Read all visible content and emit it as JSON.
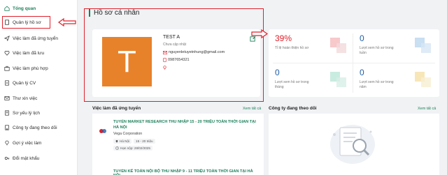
{
  "sidebar": {
    "items": [
      {
        "label": "Tổng quan",
        "icon": "home-icon"
      },
      {
        "label": "Quản lý hồ sơ",
        "icon": "document-icon"
      },
      {
        "label": "Việc làm đã ứng tuyển",
        "icon": "send-icon"
      },
      {
        "label": "Việc làm đã lưu",
        "icon": "heart-icon"
      },
      {
        "label": "Việc làm phù hợp",
        "icon": "briefcase-icon"
      },
      {
        "label": "Quản lý CV",
        "icon": "cv-icon"
      },
      {
        "label": "Thư xin việc",
        "icon": "mail-icon"
      },
      {
        "label": "Sơ yếu lý lịch",
        "icon": "resume-icon"
      },
      {
        "label": "Công ty đang theo dõi",
        "icon": "company-icon"
      },
      {
        "label": "Gợi ý việc làm",
        "icon": "suggest-icon"
      },
      {
        "label": "Đổi mật khẩu",
        "icon": "key-icon"
      }
    ]
  },
  "main": {
    "title": "Hồ sơ cá nhân",
    "profile": {
      "avatar_letter": "T",
      "name": "TEST A",
      "status": "Chưa cập nhật",
      "email": "nguyenletuyetnhung@gmail.com",
      "phone": "0987654321"
    },
    "stats": [
      {
        "value": "39%",
        "label": "Tỉ lệ hoàn thiện hồ sơ",
        "color": "#e0202a"
      },
      {
        "value": "0",
        "label": "Lượt xem hồ sơ trong tuần",
        "color": "#1f5fa8"
      },
      {
        "value": "0",
        "label": "Lượt xem hồ sơ trong tháng",
        "color": "#1f5fa8"
      },
      {
        "value": "0",
        "label": "Lượt xem hồ sơ trong năm",
        "color": "#1f5fa8"
      }
    ],
    "applied_jobs": {
      "title": "Việc làm đã ứng tuyển",
      "see_all": "Xem tất cả",
      "jobs": [
        {
          "title": "TUYỂN MARKET RESEARCH THU NHẬP 15 - 20 TRIỆU TOÀN THỜI GIAN TẠI HÀ NỘI",
          "company": "Vega Corporation",
          "location": "Hà Nội",
          "salary": "15 - 20 triệu",
          "deadline": "Hạn nộp: 28/02/2025"
        },
        {
          "title": "TUYỂN KẾ TOÁN NỘI BỘ THU NHẬP 9 - 11 TRIỆU TOÀN THỜI GIAN TẠI HÀ NỘI"
        }
      ]
    },
    "followed_companies": {
      "title": "Công ty đang theo dõi",
      "see_all": "Xem tất cả"
    }
  },
  "colors": {
    "accent": "#1a7f5a",
    "highlight": "#e0202a",
    "avatar": "#e8822a"
  }
}
